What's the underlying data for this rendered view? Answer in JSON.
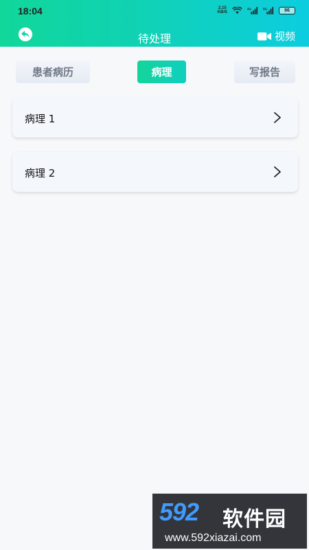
{
  "status_bar": {
    "time": "18:04",
    "net_speed_value": "2.15",
    "net_speed_unit": "KB/S",
    "signal_1_label": "4G",
    "signal_2_label": "5G",
    "battery": "96"
  },
  "header": {
    "title": "待处理",
    "video_label": "视频",
    "colors": {
      "gradient_start": "#11d79a",
      "gradient_end": "#0ccde0"
    }
  },
  "tabs": [
    {
      "label": "患者病历",
      "active": false
    },
    {
      "label": "病理",
      "active": true
    },
    {
      "label": "写报告",
      "active": false
    }
  ],
  "list": {
    "items": [
      {
        "label": "病理 1"
      },
      {
        "label": "病理 2"
      }
    ]
  },
  "watermark": {
    "number": "592",
    "brand": "软件园",
    "url": "www.592xiazai.com"
  }
}
